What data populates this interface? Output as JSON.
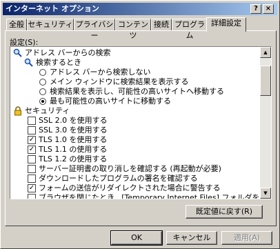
{
  "window": {
    "title": "インターネット オプション",
    "help_label": "?",
    "close_label": "×"
  },
  "tabs": [
    {
      "label": "全般"
    },
    {
      "label": "セキュリティ"
    },
    {
      "label": "プライバシー"
    },
    {
      "label": "コンテンツ"
    },
    {
      "label": "接続"
    },
    {
      "label": "プログラム"
    },
    {
      "label": "詳細設定",
      "active": true
    }
  ],
  "settings_label": "設定(S):",
  "tree": {
    "address_search": {
      "label": "アドレス バーからの検索",
      "icon": "magnifier-icon",
      "when_searching": {
        "label": "検索するとき",
        "icon": "magnifier-icon",
        "options": [
          {
            "label": "アドレス バーから検索しない",
            "selected": false
          },
          {
            "label": "メイン ウィンドウに検索結果を表示する",
            "selected": false
          },
          {
            "label": "検索結果を表示し、可能性の高いサイトへ移動する",
            "selected": false
          },
          {
            "label": "最も可能性の高いサイトに移動する",
            "selected": true
          }
        ]
      }
    },
    "security": {
      "label": "セキュリティ",
      "icon": "padlock-icon",
      "items": [
        {
          "label": "SSL 2.0 を使用する",
          "checked": false
        },
        {
          "label": "SSL 3.0 を使用する",
          "checked": false
        },
        {
          "label": "TLS 1.0 を使用する",
          "checked": true
        },
        {
          "label": "TLS 1.1 の使用する",
          "checked": true
        },
        {
          "label": "TLS 1.2 の使用する",
          "checked": false
        },
        {
          "label": "サーバー証明書の取り消しを確認する (再起動が必要)",
          "checked": false
        },
        {
          "label": "ダウンロードしたプログラムの署名を確認する",
          "checked": false
        },
        {
          "label": "フォームの送信がリダイレクトされた場合に警告する",
          "checked": true
        },
        {
          "label": "ブラウザを閉じたとき、[Temporary Internet Files] フォルダを空にする",
          "checked": false
        }
      ]
    }
  },
  "restore_button": "既定値に戻す(R)",
  "footer": {
    "ok": "OK",
    "cancel": "キャンセル",
    "apply": "適用(A)"
  },
  "colors": {
    "title_gradient_start": "#0a246a",
    "title_gradient_end": "#a6caf0",
    "face": "#d4d0c8"
  }
}
